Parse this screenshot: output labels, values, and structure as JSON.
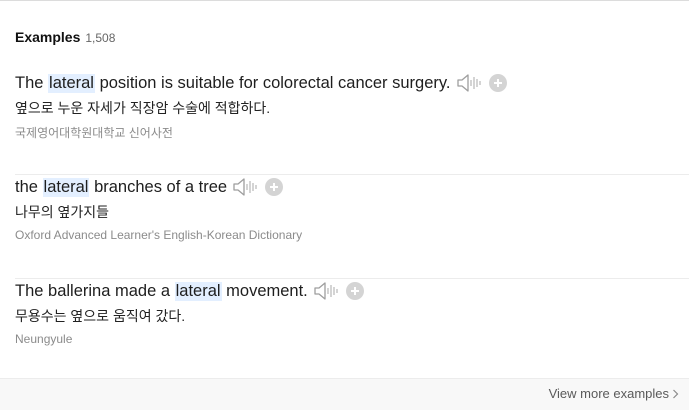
{
  "examples_section": {
    "title": "Examples",
    "count": "1,508",
    "items": [
      {
        "en_before": "The ",
        "en_highlight": "lateral",
        "en_after": " position is suitable for colorectal cancer surgery.",
        "ko": "옆으로 누운 자세가 직장암 수술에 적합하다.",
        "source": "국제영어대학원대학교 신어사전"
      },
      {
        "en_before": "the ",
        "en_highlight": "lateral",
        "en_after": " branches of a tree",
        "ko": "나무의 옆가지들",
        "source": "Oxford Advanced Learner's English-Korean Dictionary"
      },
      {
        "en_before": "The ballerina made a ",
        "en_highlight": "lateral",
        "en_after": " movement.",
        "ko": "무용수는 옆으로 움직여 갔다.",
        "source": "Neungyule"
      }
    ]
  },
  "footer": {
    "view_more_label": "View more examples"
  },
  "icons": {
    "speaker": "speaker-icon",
    "add": "plus-circle-icon",
    "chevron": "chevron-right-icon"
  },
  "colors": {
    "highlight_bg": "#e3efff",
    "icon_gray": "#bdbdbd",
    "source_gray": "#8b8b8b"
  }
}
